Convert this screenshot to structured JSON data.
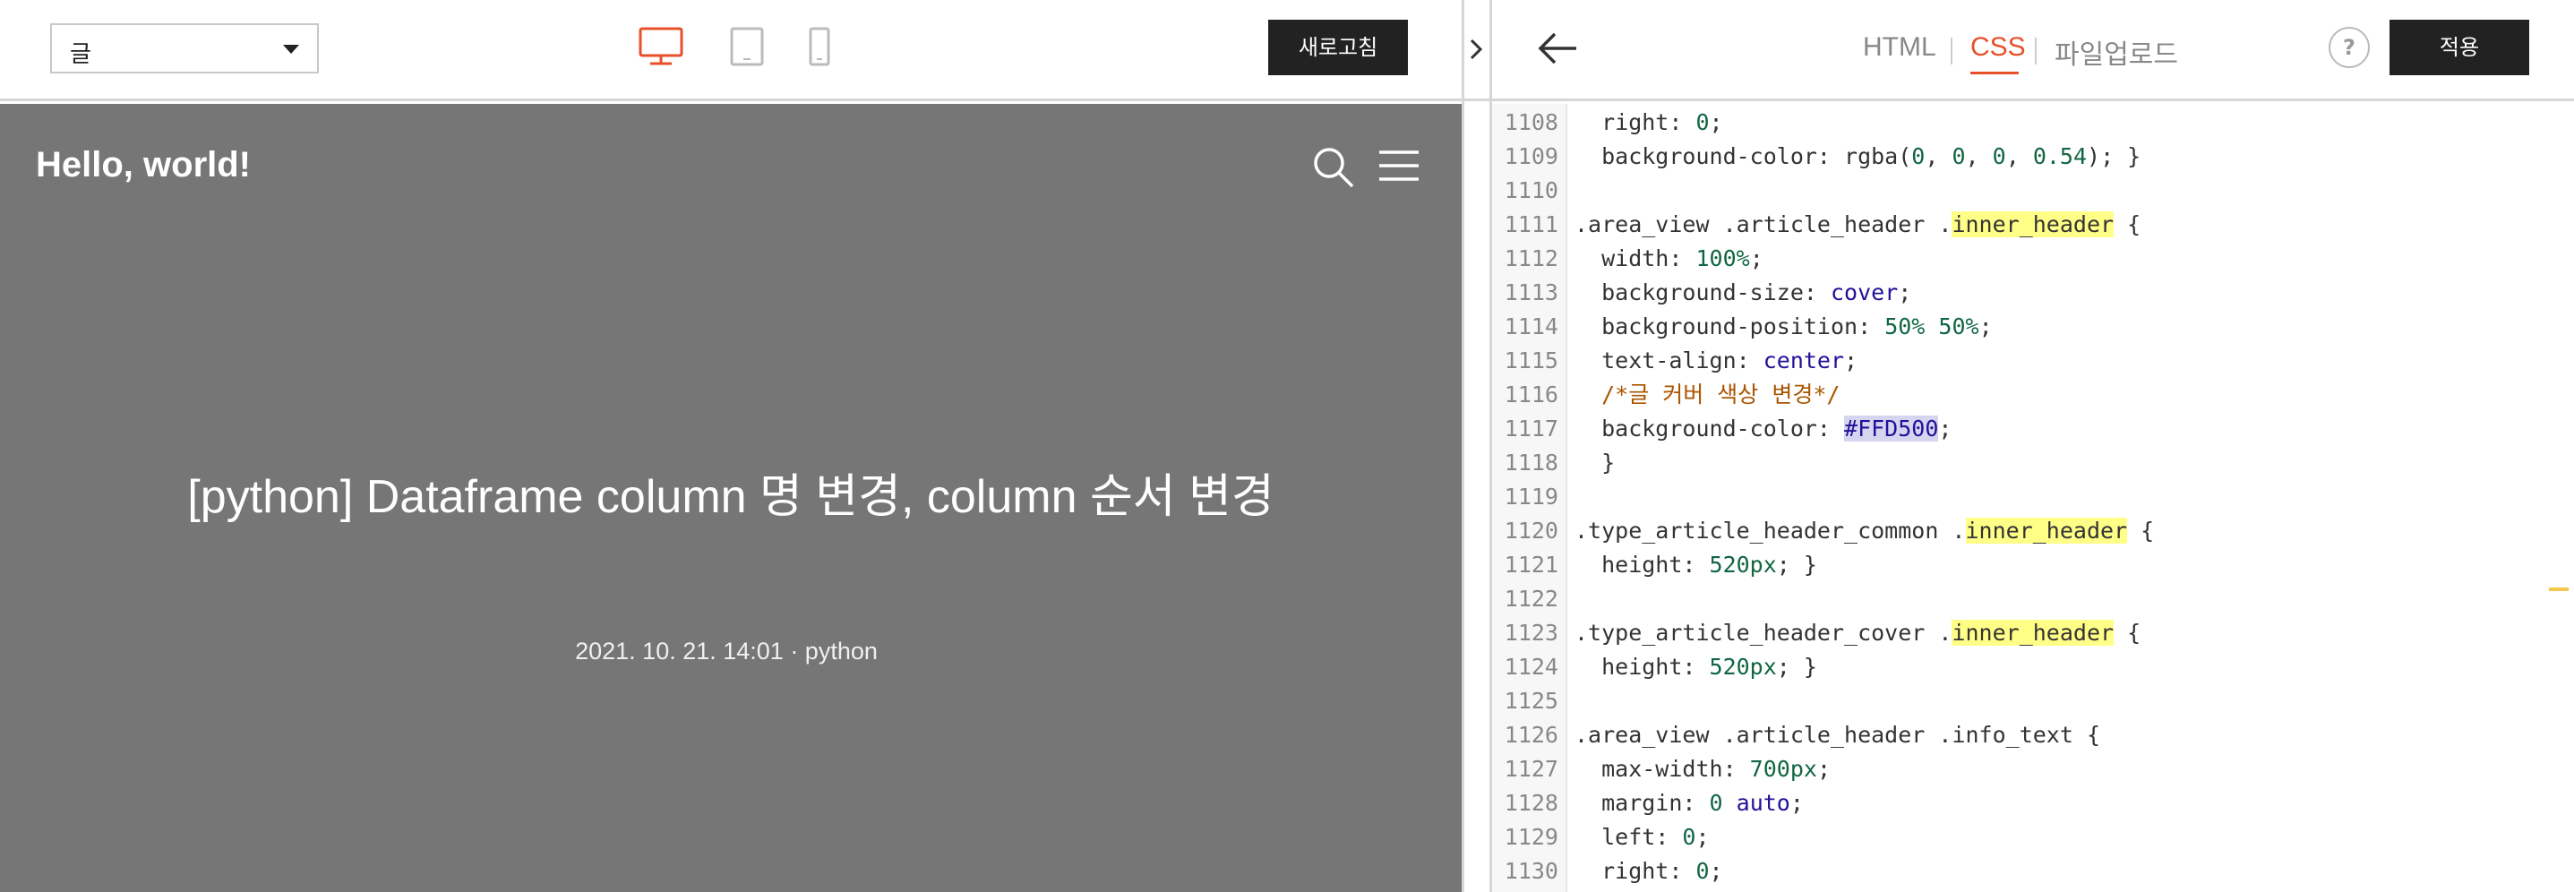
{
  "preview": {
    "page_select": {
      "value": "글"
    },
    "devices": [
      "desktop-icon",
      "tablet-icon",
      "mobile-icon"
    ],
    "active_device": "desktop",
    "refresh_label": "새로고침",
    "blog_title": "Hello, world!",
    "post_title": "[python] Dataframe column 명 변경, column 순서 변경",
    "post_meta": "2021. 10. 21. 14:01 · python",
    "colors": {
      "cover_bg": "#767676",
      "accent": "#e8502c"
    }
  },
  "editor": {
    "tabs": [
      {
        "label": "HTML"
      },
      {
        "label": "CSS"
      },
      {
        "label": "파일업로드"
      }
    ],
    "active_tab": "CSS",
    "help_label": "?",
    "apply_label": "적용",
    "code_lines": [
      {
        "no": "1108",
        "text": "  right: 0;"
      },
      {
        "no": "1109",
        "text": "  background-color: rgba(0, 0, 0, 0.54); }"
      },
      {
        "no": "1110",
        "text": ""
      },
      {
        "no": "1111",
        "text": ".area_view .article_header .inner_header {"
      },
      {
        "no": "1112",
        "text": "  width: 100%;"
      },
      {
        "no": "1113",
        "text": "  background-size: cover;"
      },
      {
        "no": "1114",
        "text": "  background-position: 50% 50%;"
      },
      {
        "no": "1115",
        "text": "  text-align: center;"
      },
      {
        "no": "1116",
        "text": "  /*글 커버 색상 변경*/"
      },
      {
        "no": "1117",
        "text": "  background-color: #FFD500;"
      },
      {
        "no": "1118",
        "text": "  }"
      },
      {
        "no": "1119",
        "text": ""
      },
      {
        "no": "1120",
        "text": ".type_article_header_common .inner_header {"
      },
      {
        "no": "1121",
        "text": "  height: 520px; }"
      },
      {
        "no": "1122",
        "text": ""
      },
      {
        "no": "1123",
        "text": ".type_article_header_cover .inner_header {"
      },
      {
        "no": "1124",
        "text": "  height: 520px; }"
      },
      {
        "no": "1125",
        "text": ""
      },
      {
        "no": "1126",
        "text": ".area_view .article_header .info_text {"
      },
      {
        "no": "1127",
        "text": "  max-width: 700px;"
      },
      {
        "no": "1128",
        "text": "  margin: 0 auto;"
      },
      {
        "no": "1129",
        "text": "  left: 0;"
      },
      {
        "no": "1130",
        "text": "  right: 0;"
      }
    ]
  }
}
